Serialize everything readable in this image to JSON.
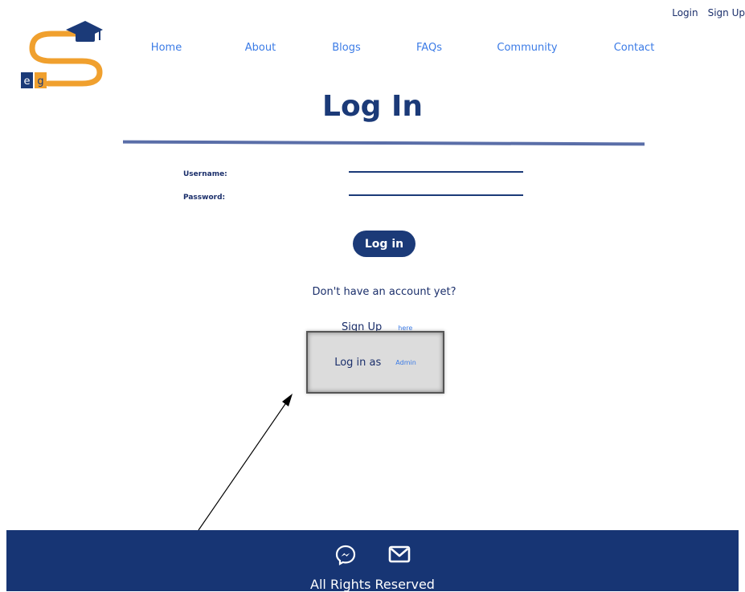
{
  "header": {
    "login_link": "Login",
    "signup_link": "Sign Up",
    "logo_letters": [
      "e",
      "g"
    ]
  },
  "nav": {
    "items": [
      {
        "label": "Home"
      },
      {
        "label": "About"
      },
      {
        "label": "Blogs"
      },
      {
        "label": "FAQs"
      },
      {
        "label": "Community"
      },
      {
        "label": "Contact"
      }
    ]
  },
  "page": {
    "title": "Log In"
  },
  "form": {
    "username_label": "Username:",
    "username_value": "",
    "password_label": "Password:",
    "password_value": "",
    "submit_label": "Log in"
  },
  "signup": {
    "prompt": "Don't have an account yet?",
    "label": "Sign Up",
    "link": "here"
  },
  "admin": {
    "label": "Log in as",
    "link": "Admin"
  },
  "footer": {
    "text": "All Rights Reserved",
    "icons": [
      "messenger-icon",
      "mail-icon"
    ]
  },
  "colors": {
    "primary": "#1b3a78",
    "link": "#3b7be6",
    "accent_orange": "#f0a02e",
    "footer_bg": "#173574"
  }
}
